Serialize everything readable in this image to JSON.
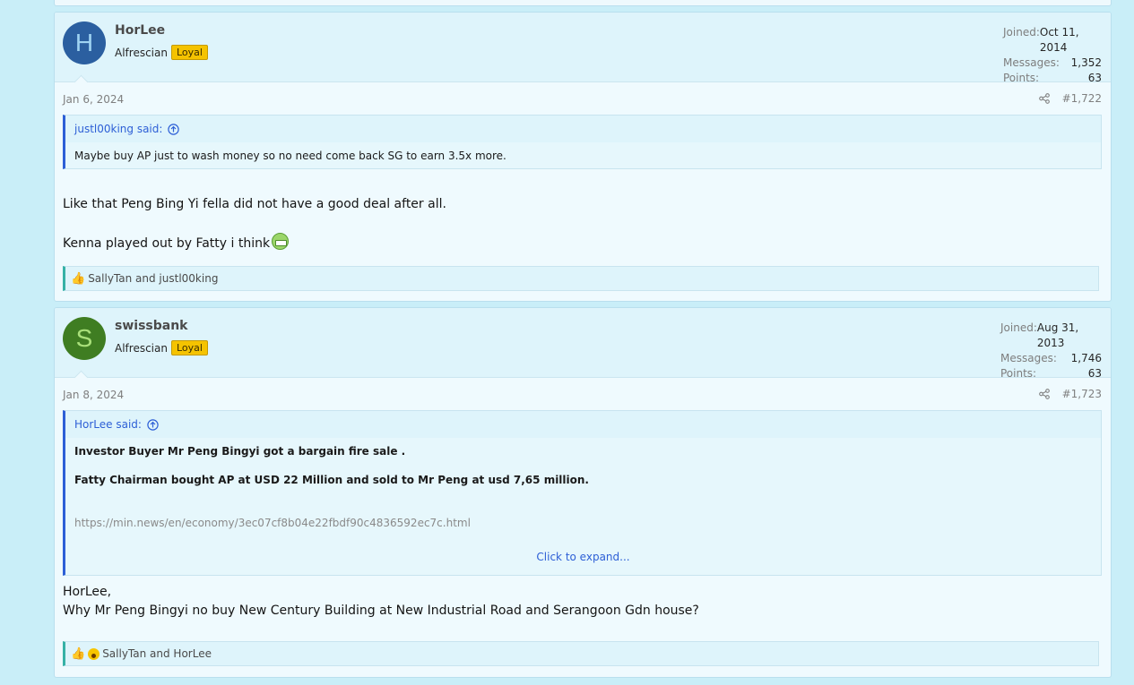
{
  "posts": [
    {
      "avatar_letter": "H",
      "username": "HorLee",
      "user_title": "Alfrescian",
      "badge": "Loyal",
      "stats": [
        {
          "label": "Joined:",
          "value": "Oct 11, 2014"
        },
        {
          "label": "Messages:",
          "value": "1,352"
        },
        {
          "label": "Points:",
          "value": "63"
        }
      ],
      "date": "Jan 6, 2024",
      "post_number": "#1,722",
      "quote": {
        "author": "justl00king said:",
        "text": "Maybe buy AP just to wash money so no need come back SG to earn 3.5x more."
      },
      "message": [
        "Like that Peng Bing Yi fella did not have a good deal after all.",
        "Kenna played out by Fatty i think"
      ],
      "reactions_text": "SallyTan and justl00king"
    },
    {
      "avatar_letter": "S",
      "username": "swissbank",
      "user_title": "Alfrescian",
      "badge": "Loyal",
      "stats": [
        {
          "label": "Joined:",
          "value": "Aug 31, 2013"
        },
        {
          "label": "Messages:",
          "value": "1,746"
        },
        {
          "label": "Points:",
          "value": "63"
        }
      ],
      "date": "Jan 8, 2024",
      "post_number": "#1,723",
      "quote": {
        "author": "HorLee said:",
        "line1": "Investor Buyer Mr Peng Bingyi got a bargain fire sale .",
        "line2": "Fatty Chairman bought AP at USD 22 Million and sold to Mr Peng at usd 7,65 million.",
        "link": "https://min.news/en/economy/3ec07cf8b04e22fbdf90c4836592ec7c.html",
        "expand": "Click to expand..."
      },
      "message": [
        "HorLee,",
        "Why Mr Peng Bingyi no buy New Century Building at New Industrial Road and Serangoon Gdn house?"
      ],
      "reactions_text": "SallyTan and HorLee"
    }
  ]
}
